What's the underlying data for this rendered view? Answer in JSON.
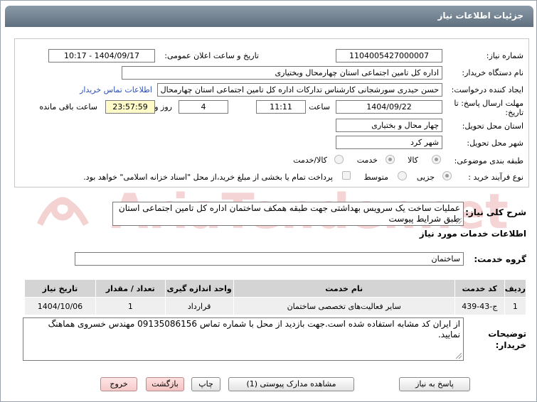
{
  "header": {
    "title": "جزئیات اطلاعات نیاز"
  },
  "form": {
    "need_number_label": "شماره نیاز:",
    "need_number": "1104005427000007",
    "announce_label": "تاریخ و ساعت اعلان عمومی:",
    "announce_value": "1404/09/17 - 10:17",
    "buyer_org_label": "نام دستگاه خریدار:",
    "buyer_org": "اداره کل تامین اجتماعی استان چهارمحال وبختیاری",
    "creator_label": "ایجاد کننده درخواست:",
    "creator": "حسن حیدری سورشجانی کارشناس تدارکات اداره کل تامین اجتماعی استان چهارمحال وبختیاری",
    "contact_link": "اطلاعات تماس خریدار",
    "deadline_label_1": "مهلت ارسال پاسخ: تا",
    "deadline_label_2": "تاریخ:",
    "deadline_date": "1404/09/22",
    "time_label": "ساعت",
    "deadline_time": "11:11",
    "days_count": "4",
    "days_label": "روز و",
    "remaining_time": "23:57:59",
    "remaining_label": "ساعت باقی مانده",
    "province_label": "استان محل تحویل:",
    "province": "چهار محال و بختیاری",
    "city_label": "شهر محل تحویل:",
    "city": "شهر کرد",
    "category_label": "طبقه بندی موضوعی:",
    "category_options": [
      "کالا",
      "خدمت",
      "کالا/خدمت"
    ],
    "process_label": "نوع فرآیند خرید :",
    "process_options": [
      "جزیی",
      "متوسط"
    ],
    "treasury_note": "پرداخت تمام یا بخشی از مبلغ خرید،از محل \"اسناد خزانه اسلامی\" خواهد بود."
  },
  "description": {
    "label": "شرح کلی نیاز:",
    "text": "عملیات ساخت یک سرویس بهداشتی جهت طبقه همکف ساختمان اداره کل تامین اجتماعی استان طبق شرایط پیوست"
  },
  "services": {
    "section_title": "اطلاعات خدمات مورد نیاز",
    "group_label": "گروه خدمت:",
    "group_value": "ساختمان",
    "columns": [
      "ردیف",
      "کد خدمت",
      "نام خدمت",
      "واحد اندازه گیری",
      "تعداد / مقدار",
      "تاریخ نیاز"
    ],
    "rows": [
      [
        "1",
        "ج-43-439",
        "سایر فعالیت‌های تخصصی ساختمان",
        "قرارداد",
        "1",
        "1404/10/06"
      ]
    ]
  },
  "buyer_notes": {
    "label_1": "توضیحات",
    "label_2": "خریدار:",
    "text": "از ایران کد مشابه استفاده شده است.جهت بازدید از محل با شماره تماس 09135086156 مهندس خسروی هماهنگ نمایید."
  },
  "buttons": {
    "reply": "پاسخ به نیاز",
    "view_docs": "مشاهده مدارک پیوستی (1)",
    "print": "چاپ",
    "back": "بازگشت",
    "exit": "خروج"
  },
  "watermark": {
    "text": "AriaTender.net"
  },
  "colors": {
    "header": "#6e7f8e",
    "link": "#2a4fb8",
    "watermark": "#f2caca"
  }
}
